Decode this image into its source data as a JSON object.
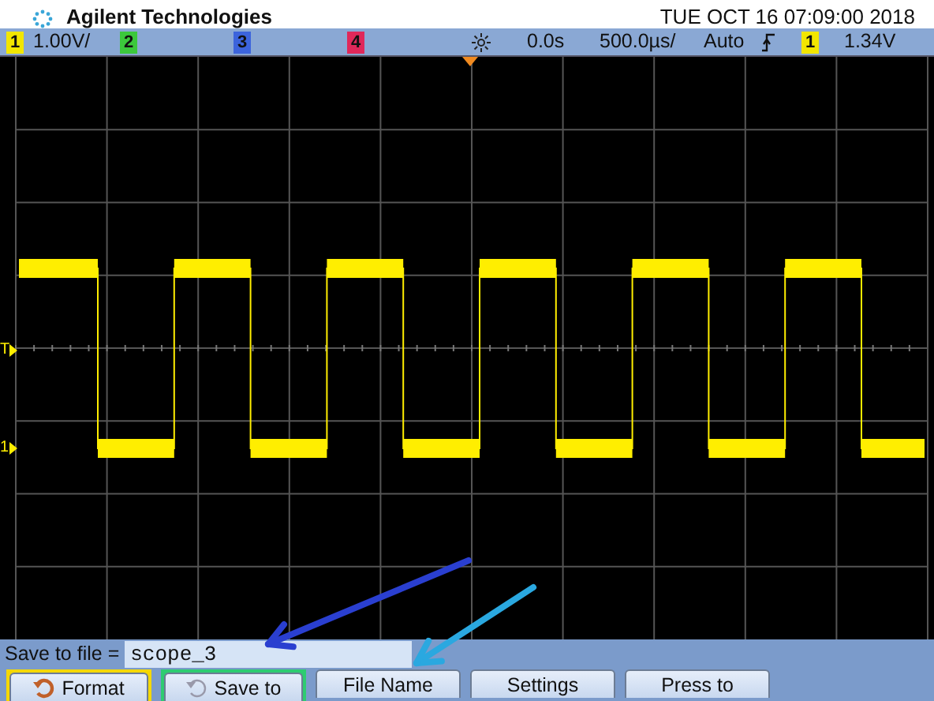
{
  "header": {
    "brand": "Agilent Technologies",
    "datetime": "TUE OCT 16 07:09:00 2018"
  },
  "status_bar": {
    "channels": [
      {
        "number": "1",
        "color": "#f2e600",
        "reading": "1.00V/"
      },
      {
        "number": "2",
        "color": "#3cc83c"
      },
      {
        "number": "3",
        "color": "#3c64dc"
      },
      {
        "number": "4",
        "color": "#e0285a"
      }
    ],
    "time_position": "0.0s",
    "time_scale": "500.0µs/",
    "trigger_mode": "Auto",
    "trigger_source": {
      "number": "1",
      "color": "#f2e600"
    },
    "trigger_level": "1.34V"
  },
  "display": {
    "markers": [
      {
        "kind": "trigger",
        "label": "T"
      },
      {
        "kind": "channel",
        "label": "1"
      }
    ]
  },
  "save_row": {
    "label": "Save to file =",
    "value": "scope_3"
  },
  "softkeys": [
    {
      "kind": "toggle",
      "label": "Format",
      "disabled": false,
      "color": "#f5d800"
    },
    {
      "kind": "toggle",
      "label": "Save to",
      "disabled": true,
      "color": "#2ecc71"
    },
    {
      "kind": "plain",
      "label": "File Name"
    },
    {
      "kind": "plain",
      "label": "Settings"
    },
    {
      "kind": "plain",
      "label": "Press to"
    }
  ],
  "annotations": [
    {
      "kind": "arrow",
      "color": "#2a3fd0"
    },
    {
      "kind": "arrow",
      "color": "#2aa8e0"
    }
  ]
}
